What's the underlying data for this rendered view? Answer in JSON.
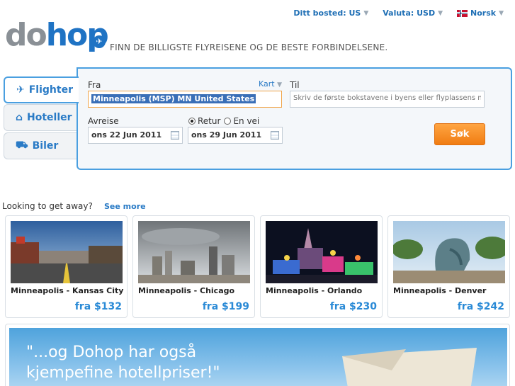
{
  "header": {
    "location_label": "Ditt bosted: US",
    "currency_label": "Valuta: USD",
    "language_label": "Norsk"
  },
  "logo": {
    "part1": "do",
    "part2": "hop"
  },
  "tagline": "FINN DE BILLIGSTE FLYREISENE OG DE BESTE FORBINDELSENE.",
  "tabs": [
    {
      "label": "Flighter",
      "icon": "plane-icon"
    },
    {
      "label": "Hoteller",
      "icon": "house-icon"
    },
    {
      "label": "Biler",
      "icon": "car-icon"
    }
  ],
  "search": {
    "from_label": "Fra",
    "from_value": "Minneapolis (MSP) MN United States",
    "map_link": "Kart",
    "to_label": "Til",
    "to_placeholder": "Skriv de første bokstavene i byens eller flyplassens n",
    "depart_label": "Avreise",
    "depart_value": "ons 22 Jun 2011",
    "return_option": "Retur",
    "oneway_option": "En vei",
    "return_value": "ons 29 Jun 2011",
    "search_button": "Søk"
  },
  "getaway": {
    "heading": "Looking to get away?",
    "see_more": "See more",
    "deals": [
      {
        "route": "Minneapolis - Kansas City",
        "price": "fra $132"
      },
      {
        "route": "Minneapolis - Chicago",
        "price": "fra $199"
      },
      {
        "route": "Minneapolis - Orlando",
        "price": "fra $230"
      },
      {
        "route": "Minneapolis - Denver",
        "price": "fra $242"
      }
    ]
  },
  "hotel_banner": {
    "line1": "\"...og Dohop har også",
    "line2": "kjempefine hotellpriser!\""
  },
  "colors": {
    "brand_blue": "#1f73c4",
    "accent_orange": "#f07c12",
    "price_blue": "#2a8ad6"
  }
}
